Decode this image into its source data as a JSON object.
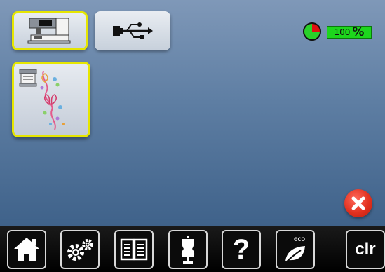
{
  "header": {
    "machine_button_icon": "sewing-machine-icon",
    "usb_button_icon": "usb-icon",
    "memory": {
      "value": "100",
      "unit": "%",
      "used_fraction": 0.25,
      "pie_colors": {
        "used": "#e01010",
        "free": "#2ad12a"
      },
      "bar_color": "#1dd61d"
    }
  },
  "main": {
    "design_tile": {
      "icon": "embroidery-design-thumbnail",
      "selected": true
    },
    "close_icon": "close-icon"
  },
  "bottom_bar": {
    "home_icon": "home-icon",
    "setup_icon": "gears-icon",
    "tutorial_icon": "book-icon",
    "consultant_icon": "dress-form-icon",
    "help_label": "?",
    "eco_label": "eco",
    "clr_label": "clr"
  },
  "colors": {
    "highlight": "#e6e600",
    "background_top": "#7f98b8",
    "background_bottom": "#3f628a"
  }
}
